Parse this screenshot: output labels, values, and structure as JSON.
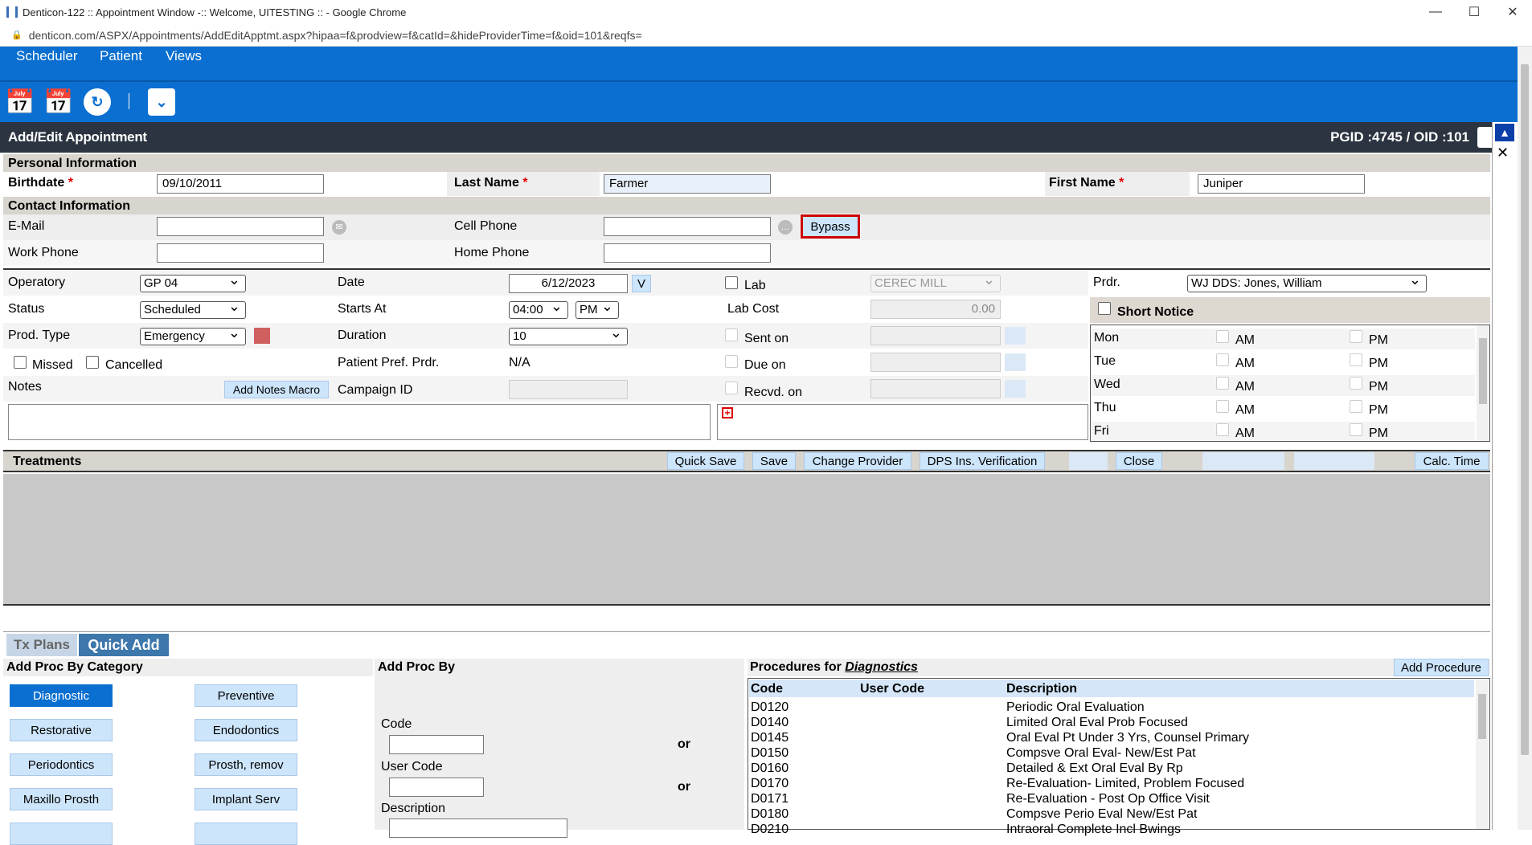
{
  "browser": {
    "window_title": "Denticon-122 :: Appointment Window -:: Welcome, UITESTING :: - Google Chrome",
    "url": "denticon.com/ASPX/Appointments/AddEditApptmt.aspx?hipaa=f&prodview=f&catId=&hideProviderTime=f&oid=101&reqfs="
  },
  "menu": {
    "scheduler": "Scheduler",
    "patient": "Patient",
    "views": "Views"
  },
  "header": {
    "title": "Add/Edit Appointment",
    "ids": "PGID :4745  /  OID :101"
  },
  "personal": {
    "section": "Personal Information",
    "birthdate_label": "Birthdate",
    "birthdate": "09/10/2011",
    "lastname_label": "Last Name",
    "lastname": "Farmer",
    "firstname_label": "First Name",
    "firstname": "Juniper",
    "req": "*"
  },
  "contact": {
    "section": "Contact Information",
    "email_label": "E-Mail",
    "email": "",
    "cell_label": "Cell Phone",
    "cell": "",
    "bypass": "Bypass",
    "work_label": "Work Phone",
    "work": "",
    "home_label": "Home Phone",
    "home": ""
  },
  "appt": {
    "operatory_label": "Operatory",
    "operatory": "GP 04",
    "status_label": "Status",
    "status": "Scheduled",
    "prodtype_label": "Prod. Type",
    "prodtype": "Emergency",
    "missed_label": "Missed",
    "cancelled_label": "Cancelled",
    "notes_label": "Notes",
    "add_notes_macro": "Add Notes Macro",
    "date_label": "Date",
    "date": "6/12/2023",
    "date_btn": "V",
    "starts_label": "Starts At",
    "starts_time": "04:00",
    "starts_ampm": "PM",
    "duration_label": "Duration",
    "duration": "10",
    "pref_prdr_label": "Patient Pref. Prdr.",
    "pref_prdr": "N/A",
    "campaign_label": "Campaign ID",
    "lab_label": "Lab",
    "lab_value": "CEREC MILL",
    "labcost_label": "Lab Cost",
    "labcost": "0.00",
    "sent_label": "Sent on",
    "due_label": "Due on",
    "recvd_label": "Recvd. on",
    "prdr_label": "Prdr.",
    "prdr": "WJ DDS: Jones, William",
    "short_notice_label": "Short Notice",
    "days": [
      "Mon",
      "Tue",
      "Wed",
      "Thu",
      "Fri"
    ],
    "am": "AM",
    "pm": "PM"
  },
  "treatments": {
    "title": "Treatments",
    "quick_save": "Quick Save",
    "save": "Save",
    "change_provider": "Change Provider",
    "dps": "DPS Ins. Verification",
    "close": "Close",
    "calc_time": "Calc. Time"
  },
  "tabs": {
    "tx_plans": "Tx Plans",
    "quick_add": "Quick Add"
  },
  "category": {
    "title": "Add Proc By Category",
    "items": [
      "Diagnostic",
      "Preventive",
      "Restorative",
      "Endodontics",
      "Periodontics",
      "Prosth, remov",
      "Maxillo Prosth",
      "Implant Serv"
    ]
  },
  "addby": {
    "title": "Add Proc By",
    "code_label": "Code",
    "usercode_label": "User Code",
    "desc_label": "Description",
    "or": "or"
  },
  "procedures": {
    "title_prefix": "Procedures for ",
    "title_cat": "Diagnostics",
    "add_btn": "Add Procedure",
    "headers": [
      "Code",
      "User Code",
      "Description"
    ],
    "rows": [
      [
        "D0120",
        "",
        "Periodic Oral Evaluation"
      ],
      [
        "D0140",
        "",
        "Limited Oral Eval Prob Focused"
      ],
      [
        "D0145",
        "",
        "Oral Eval Pt Under 3 Yrs, Counsel Primary"
      ],
      [
        "D0150",
        "",
        "Compsve Oral Eval- New/Est Pat"
      ],
      [
        "D0160",
        "",
        "Detailed & Ext Oral Eval By Rp"
      ],
      [
        "D0170",
        "",
        "Re-Evaluation- Limited, Problem Focused"
      ],
      [
        "D0171",
        "",
        "Re-Evaluation - Post Op Office Visit"
      ],
      [
        "D0180",
        "",
        "Compsve Perio Eval New/Est Pat"
      ],
      [
        "D0210",
        "",
        "Intraoral Complete Incl Bwings"
      ]
    ]
  }
}
